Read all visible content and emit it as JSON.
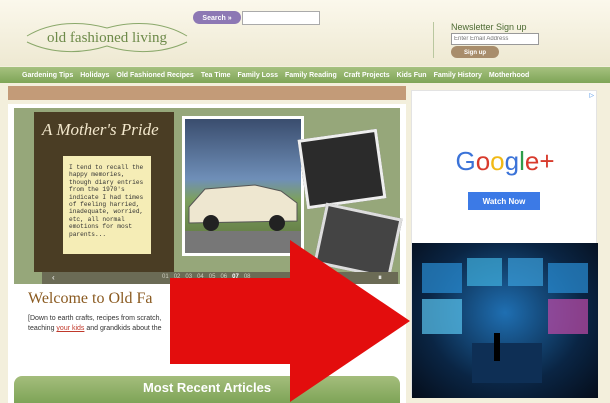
{
  "header": {
    "logo_text": "old fashioned living",
    "search_button": "Search »",
    "newsletter_title": "Newsletter Sign up",
    "newsletter_placeholder": "Enter Email Address",
    "signup_button": "Sign up"
  },
  "nav": [
    "Gardening Tips",
    "Holidays",
    "Old Fashioned Recipes",
    "Tea Time",
    "Family Loss",
    "Family Reading",
    "Craft Projects",
    "Kids Fun",
    "Family History",
    "Motherhood"
  ],
  "slideshow": {
    "title": "A Mother's Pride",
    "note": "I tend to recall the happy memories, though diary entries from the 1970's indicate I had times of feeling harried, inadequate, worried, etc, all normal emotions for most parents...",
    "pages": [
      "01",
      "02",
      "03",
      "04",
      "05",
      "06",
      "07",
      "08"
    ],
    "active_page": "07"
  },
  "welcome": {
    "heading": "Welcome to Old Fa",
    "blurb_before": "[Down to earth crafts, recipes from scratch,",
    "blurb_line2_before": "teaching ",
    "blurb_link": "your kids",
    "blurb_line2_after": " and grandkids about the"
  },
  "recent": {
    "title": "Most Recent Articles"
  },
  "ad": {
    "logo": "Google+",
    "button": "Watch Now"
  },
  "colors": {
    "nav_green": "#8fb265",
    "accent_red": "#e30d0d",
    "ad_blue": "#3c7ae6"
  }
}
